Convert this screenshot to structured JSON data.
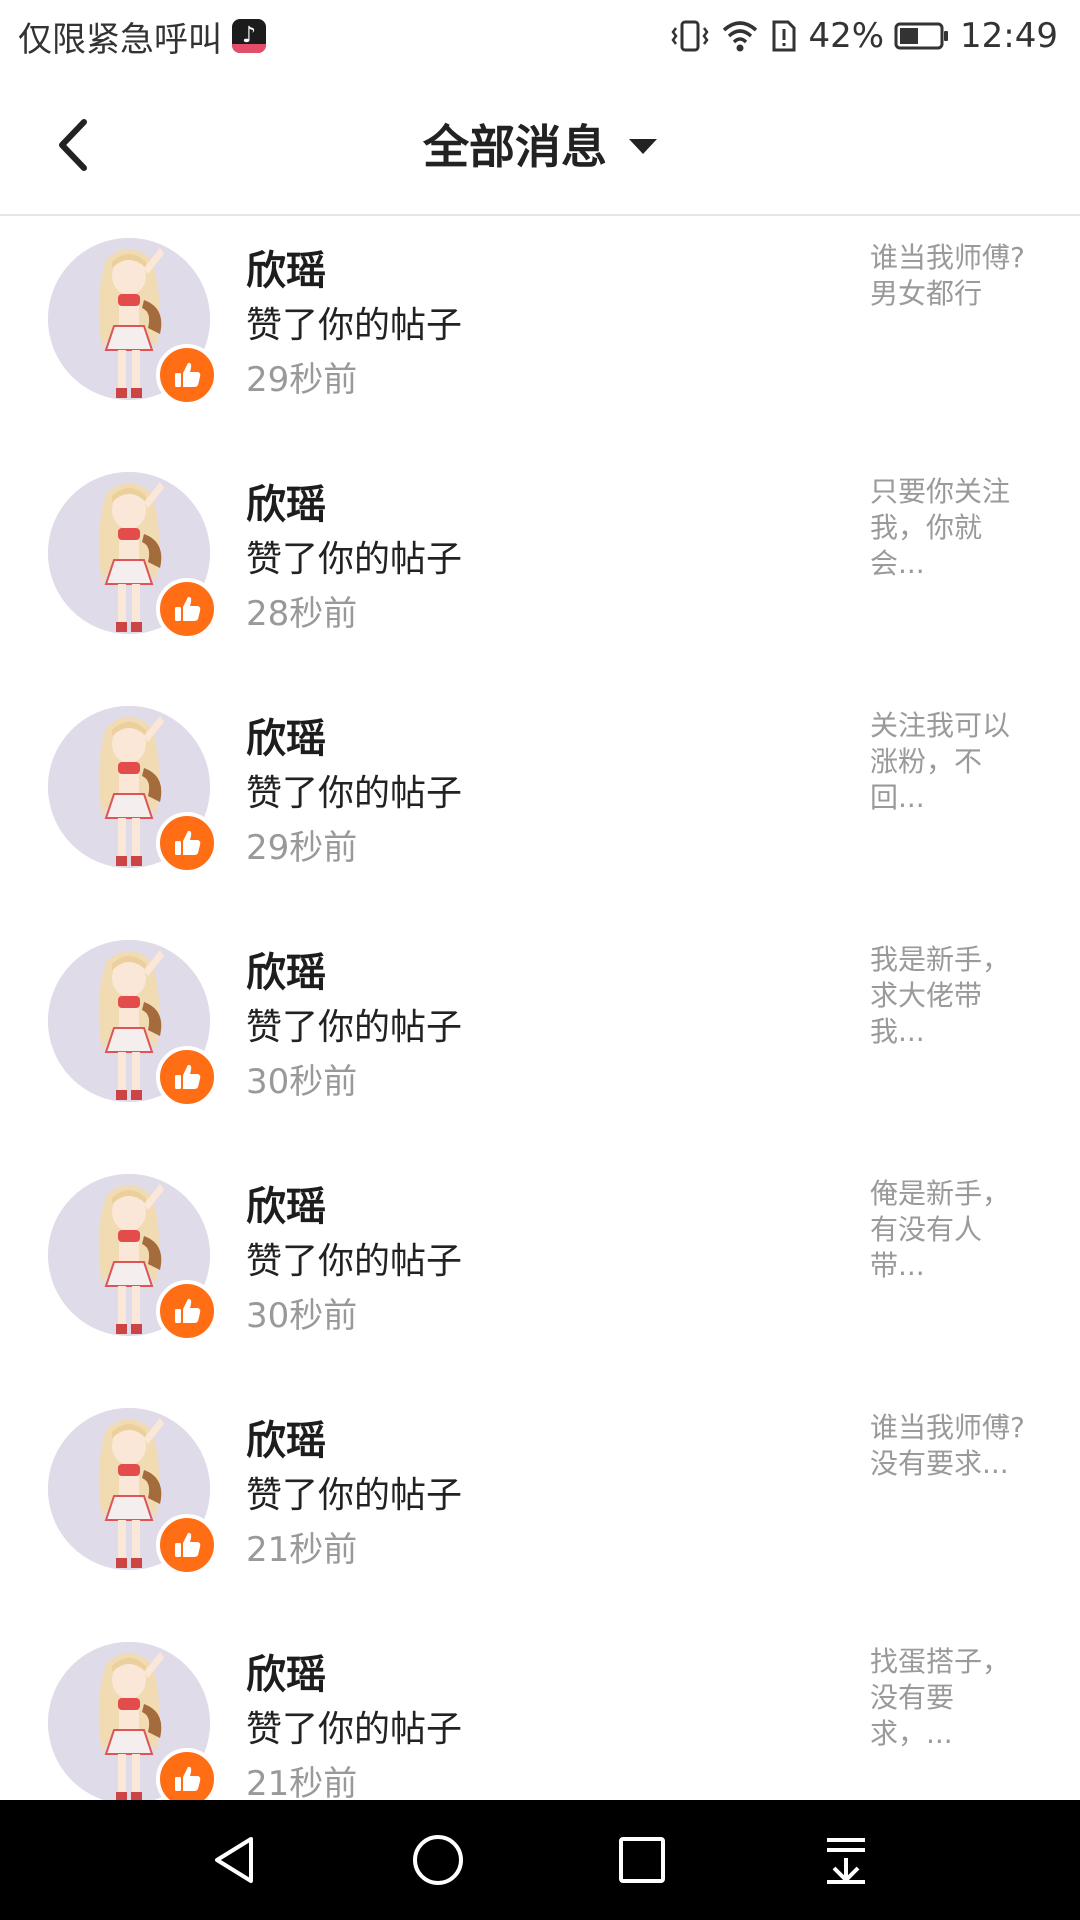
{
  "status_bar": {
    "carrier": "仅限紧急呼叫",
    "app_icon": "tiktok-icon",
    "battery_percent": "42%",
    "time": "12:49",
    "icons": [
      "vibrate-icon",
      "wifi-icon",
      "battery-alert-icon",
      "battery-icon"
    ]
  },
  "header": {
    "back_icon": "chevron-left-icon",
    "title": "全部消息",
    "dropdown_icon": "caret-down-icon"
  },
  "messages": [
    {
      "name": "欣瑶",
      "action": "赞了你的帖子",
      "time": "29秒前",
      "preview": "谁当我师傅?男女都行"
    },
    {
      "name": "欣瑶",
      "action": "赞了你的帖子",
      "time": "28秒前",
      "preview": "只要你关注我，你就会..."
    },
    {
      "name": "欣瑶",
      "action": "赞了你的帖子",
      "time": "29秒前",
      "preview": "关注我可以涨粉，不回..."
    },
    {
      "name": "欣瑶",
      "action": "赞了你的帖子",
      "time": "30秒前",
      "preview": "我是新手，求大佬带我..."
    },
    {
      "name": "欣瑶",
      "action": "赞了你的帖子",
      "time": "30秒前",
      "preview": "俺是新手，有没有人带..."
    },
    {
      "name": "欣瑶",
      "action": "赞了你的帖子",
      "time": "21秒前",
      "preview": "谁当我师傅?没有要求..."
    },
    {
      "name": "欣瑶",
      "action": "赞了你的帖子",
      "time": "21秒前",
      "preview": "找蛋搭子，没有要求，..."
    }
  ],
  "nav_bar": {
    "icons": [
      "back-triangle-icon",
      "home-circle-icon",
      "recents-square-icon",
      "notification-pulldown-icon"
    ]
  },
  "colors": {
    "like_badge": "#ff6e14",
    "avatar_bg": "#e0dbe8",
    "muted_text": "#999999",
    "nav_bg": "#000000"
  }
}
